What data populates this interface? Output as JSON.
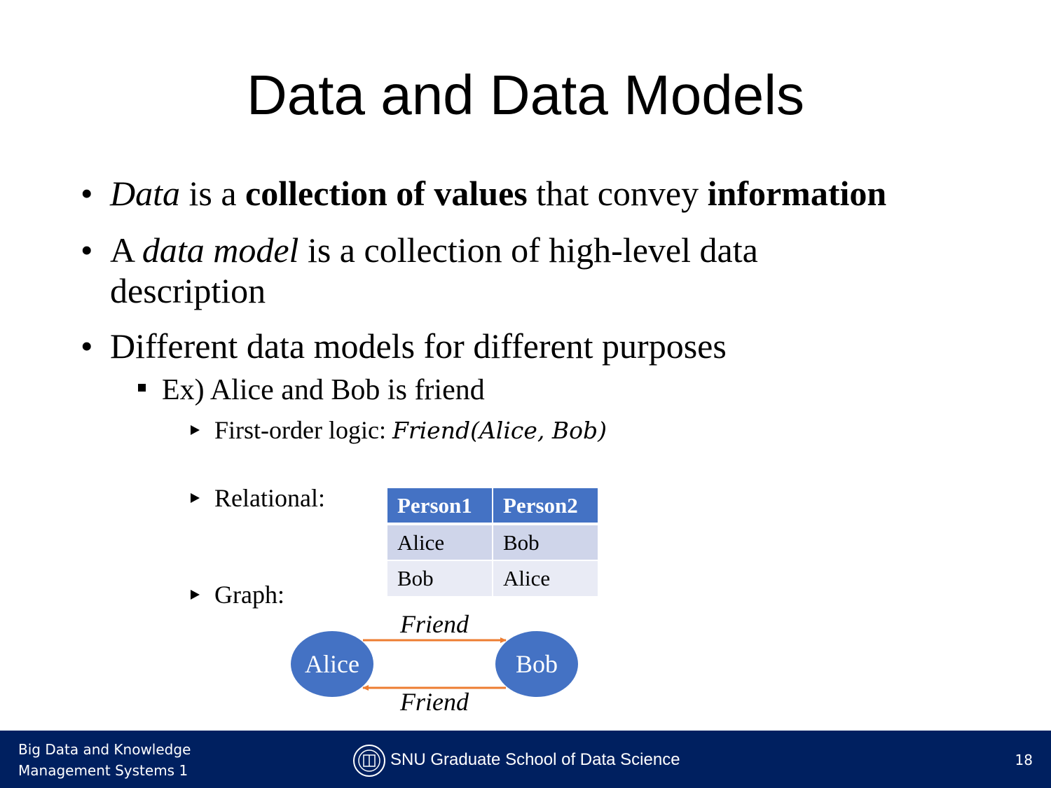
{
  "slide": {
    "title": "Data and Data Models",
    "bullets": [
      {
        "parts": [
          {
            "text": "Data",
            "style": "italic"
          },
          {
            "text": " is a ",
            "style": "normal"
          },
          {
            "text": "collection of values",
            "style": "bold"
          },
          {
            "text": " that convey ",
            "style": "normal"
          },
          {
            "text": "information",
            "style": "bold"
          }
        ]
      },
      {
        "parts": [
          {
            "text": "A ",
            "style": "normal"
          },
          {
            "text": "data model",
            "style": "italic"
          },
          {
            "text": " is a collection of high-level data",
            "style": "normal"
          }
        ],
        "line2": "description"
      },
      {
        "text": "Different data models for different purposes"
      }
    ],
    "example": "Ex) Alice and Bob is friend",
    "first_order": {
      "label": "First-order logic: ",
      "formula": "Friend(Alice, Bob)"
    },
    "relational": {
      "label": "Relational:",
      "headers": [
        "Person1",
        "Person2"
      ],
      "rows": [
        [
          "Alice",
          "Bob"
        ],
        [
          "Bob",
          "Alice"
        ]
      ]
    },
    "graph": {
      "label": "Graph:",
      "nodes": [
        "Alice",
        "Bob"
      ],
      "edge_label_top": "Friend",
      "edge_label_bottom": "Friend",
      "node_color": "#4472c4",
      "edge_color": "#ed7d31"
    }
  },
  "footer": {
    "course_line1": "Big Data and Knowledge",
    "course_line2": "Management Systems 1",
    "school": "SNU Graduate School of Data Science",
    "page": "18"
  }
}
